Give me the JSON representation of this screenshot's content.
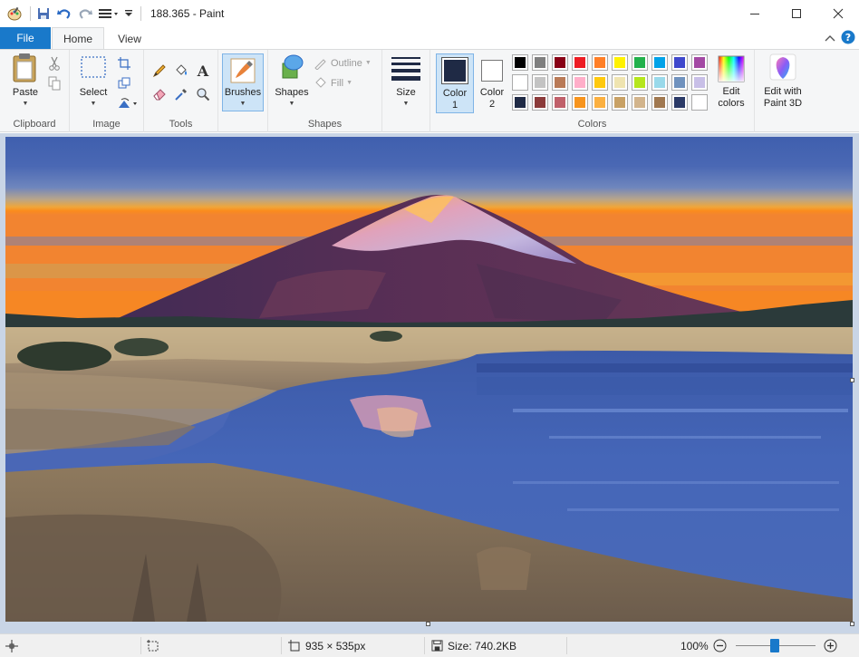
{
  "window": {
    "title": "188.365 - Paint",
    "accent_color": "#1979ca"
  },
  "tabs": {
    "file": "File",
    "home": "Home",
    "view": "View"
  },
  "ribbon": {
    "clipboard": {
      "label": "Clipboard",
      "paste": "Paste"
    },
    "image": {
      "label": "Image",
      "select": "Select"
    },
    "tools": {
      "label": "Tools"
    },
    "brushes": {
      "label": "Brushes"
    },
    "shapes": {
      "label": "Shapes",
      "shapes_btn": "Shapes",
      "outline": "Outline",
      "fill": "Fill"
    },
    "size": {
      "label": "Size"
    },
    "colors": {
      "label": "Colors",
      "color1_line1": "Color",
      "color1_line2": "1",
      "color2_line1": "Color",
      "color2_line2": "2",
      "edit_line1": "Edit",
      "edit_line2": "colors",
      "color1_value": "#1f2a45",
      "color2_value": "#ffffff",
      "palette_row1": [
        "#000000",
        "#7f7f7f",
        "#880015",
        "#ed1c24",
        "#ff7f27",
        "#fff200",
        "#22b14c",
        "#00a2e8",
        "#3f48cc",
        "#a349a4"
      ],
      "palette_row2": [
        "#ffffff",
        "#c3c3c3",
        "#b97a57",
        "#ffaec9",
        "#ffc90e",
        "#efe4b0",
        "#b5e61d",
        "#99d9ea",
        "#7092be",
        "#c8bfe7"
      ],
      "palette_row3": [
        "#1f2a45",
        "#8b3a3a",
        "#c0606a",
        "#f7941d",
        "#fbb040",
        "#c8a165",
        "#d2b48c",
        "#a07850",
        "#2b3a67",
        "#ffffff"
      ]
    },
    "paint3d": {
      "line1": "Edit with",
      "line2": "Paint 3D"
    }
  },
  "status": {
    "dimensions": "935 × 535px",
    "size": "Size: 740.2KB",
    "zoom": "100%"
  }
}
